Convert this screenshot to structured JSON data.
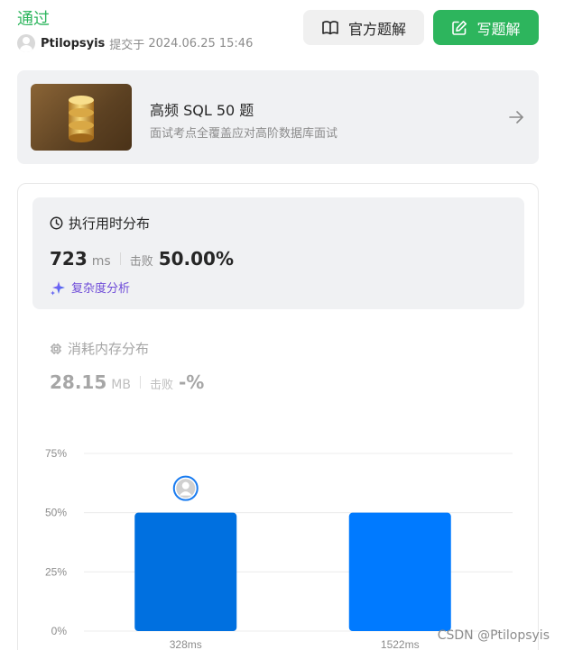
{
  "header": {
    "status": "通过",
    "author": "Ptilopsyis",
    "submitted_label": "提交于",
    "submitted_time": "2024.06.25 15:46",
    "official_solution_label": "官方题解",
    "write_solution_label": "写题解"
  },
  "promo": {
    "title": "高频 SQL 50 题",
    "subtitle": "面试考点全覆盖应对高阶数据库面试"
  },
  "runtime": {
    "title": "执行用时分布",
    "value": "723",
    "unit": "ms",
    "beat_label": "击败",
    "beat_value": "50.00%",
    "complexity_label": "复杂度分析"
  },
  "memory": {
    "title": "消耗内存分布",
    "value": "28.15",
    "unit": "MB",
    "beat_label": "击败",
    "beat_value": "-%"
  },
  "chart_data": {
    "type": "bar",
    "categories": [
      "328ms",
      "1522ms"
    ],
    "values": [
      50,
      50
    ],
    "ylim": [
      0,
      75
    ],
    "yticks": [
      "0%",
      "25%",
      "50%",
      "75%"
    ],
    "grid": true,
    "colors": [
      "#0070e0",
      "#007aff"
    ],
    "highlight_index": 0
  },
  "watermark": "CSDN @Ptilopsyis",
  "colors": {
    "accent_green": "#2db55d",
    "promo_bg": "#f0f1f3",
    "bar_primary": "#0070e0",
    "bar_secondary": "#007aff"
  }
}
